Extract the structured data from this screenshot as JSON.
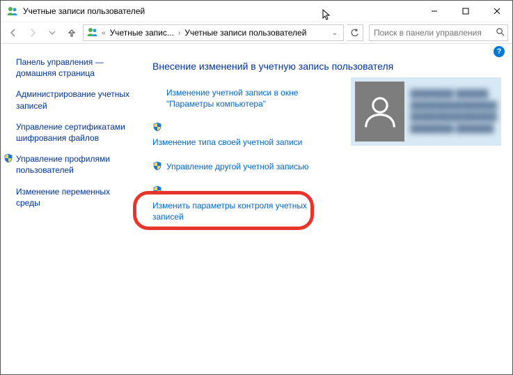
{
  "titlebar": {
    "title": "Учетные записи пользователей"
  },
  "navbar": {
    "crumb1": "Учетные запис...",
    "crumb2": "Учетные записи пользователей",
    "search_placeholder": "Поиск в панели управления"
  },
  "sidebar": {
    "items": [
      {
        "label": "Панель управления — домашняя страница"
      },
      {
        "label": "Администрирование учетных записей"
      },
      {
        "label": "Управление сертификатами шифрования файлов"
      },
      {
        "label": "Управление профилями пользователей"
      },
      {
        "label": "Изменение переменных среды"
      }
    ]
  },
  "main": {
    "heading": "Внесение изменений в учетную запись пользователя",
    "links": [
      {
        "label": "Изменение учетной записи в окне \"Параметры компьютера\"",
        "shield": false
      },
      {
        "label": "Изменение типа своей учетной записи",
        "shield": true
      },
      {
        "label": "Управление другой учетной записью",
        "shield": true
      },
      {
        "label": "Изменить параметры контроля учетных записей",
        "shield": true
      }
    ]
  },
  "user": {
    "line1": "████████ ██████",
    "line2": "████████████████",
    "line3": "████████████████",
    "line4": "████████ ███████"
  }
}
